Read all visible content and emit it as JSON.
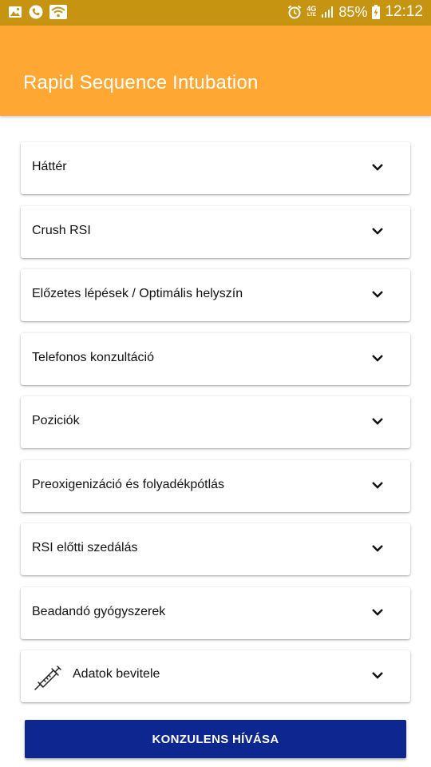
{
  "status_bar": {
    "network": "4G",
    "network_sub": "LTE",
    "battery": "85%",
    "time": "12:12",
    "icons_left": [
      "image-icon",
      "phone-icon",
      "wifi-icon"
    ],
    "icons_right": [
      "alarm-icon",
      "signal-icon",
      "battery-charging-icon"
    ]
  },
  "app_bar": {
    "title": "Rapid Sequence Intubation",
    "color": "#ffa733"
  },
  "sections": [
    {
      "label": "Háttér",
      "icon": "chevron-down-icon"
    },
    {
      "label": "Crush RSI",
      "icon": "chevron-down-icon"
    },
    {
      "label": "Előzetes lépések / Optimális helyszín",
      "icon": "chevron-down-icon"
    },
    {
      "label": "Telefonos konzultáció",
      "icon": "chevron-down-icon"
    },
    {
      "label": "Poziciók",
      "icon": "chevron-down-icon"
    },
    {
      "label": "Preoxigenizáció és folyadékpótlás",
      "icon": "chevron-down-icon"
    },
    {
      "label": "RSI előtti szedálás",
      "icon": "chevron-down-icon"
    },
    {
      "label": "Beadandó gyógyszerek",
      "icon": "chevron-down-icon"
    },
    {
      "label": "Adatok bevitele",
      "icon": "chevron-down-icon",
      "leading_icon": "syringe-icon"
    }
  ],
  "call_button": {
    "label": "KONZULENS HÍVÁSA",
    "color": "#0d2690"
  }
}
